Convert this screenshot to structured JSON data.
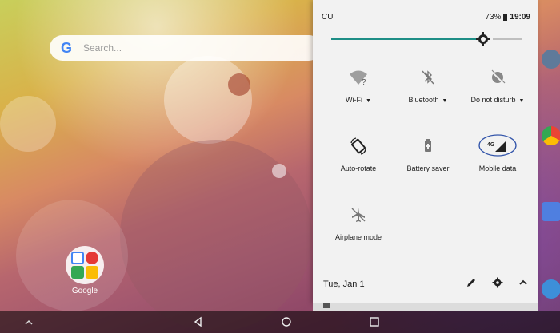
{
  "home": {
    "search_placeholder": "Search...",
    "google_letter": "G",
    "folder_label": "Google"
  },
  "quick_settings": {
    "carrier": "CU",
    "battery": "73%",
    "time": "19:09",
    "brightness_level": 0.79,
    "tiles": [
      {
        "label": "Wi-Fi",
        "icon": "wifi-unknown-icon",
        "has_dropdown": true
      },
      {
        "label": "Bluetooth",
        "icon": "bluetooth-off-icon",
        "has_dropdown": true
      },
      {
        "label": "Do not disturb",
        "icon": "do-not-disturb-off-icon",
        "has_dropdown": true
      },
      {
        "label": "Auto-rotate",
        "icon": "auto-rotate-icon"
      },
      {
        "label": "Battery saver",
        "icon": "battery-saver-icon"
      },
      {
        "label": "Mobile data",
        "icon": "mobile-data-4g-icon",
        "network": "4G"
      },
      {
        "label": "Airplane mode",
        "icon": "airplane-off-icon"
      }
    ],
    "date": "Tue, Jan 1"
  },
  "colors": {
    "accent": "#1e8e86",
    "panel_bg": "#f2f2f2",
    "highlight_ring": "#3355aa"
  }
}
